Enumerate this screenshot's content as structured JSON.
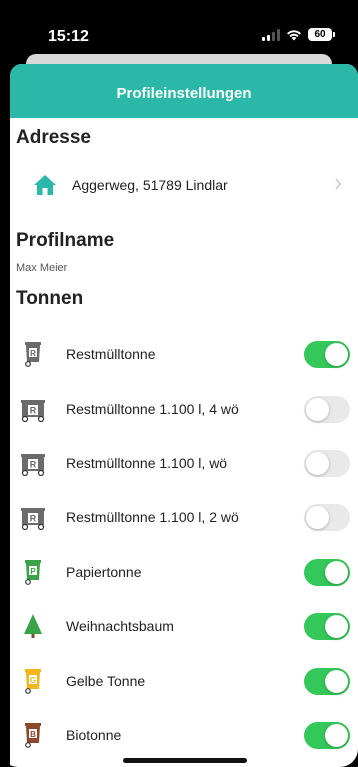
{
  "status_bar": {
    "time": "15:12",
    "battery": "60"
  },
  "header": {
    "title": "Profileinstellungen"
  },
  "sections": {
    "address_title": "Adresse",
    "address_value": "Aggerweg, 51789 Lindlar",
    "profile_title": "Profilname",
    "profile_value": "Max Meier",
    "bins_title": "Tonnen"
  },
  "bins": [
    {
      "label": "Restmülltonne",
      "letter": "R",
      "icon": "small-bin-icon",
      "color": "#6b6b6b",
      "enabled": true
    },
    {
      "label": "Restmülltonne 1.100 l, 4 wö",
      "letter": "R",
      "icon": "large-container-icon",
      "color": "#6b6b6b",
      "enabled": false
    },
    {
      "label": "Restmülltonne 1.100 l, wö",
      "letter": "R",
      "icon": "large-container-icon",
      "color": "#6b6b6b",
      "enabled": false
    },
    {
      "label": "Restmülltonne 1.100 l, 2 wö",
      "letter": "R",
      "icon": "large-container-icon",
      "color": "#6b6b6b",
      "enabled": false
    },
    {
      "label": "Papiertonne",
      "letter": "P",
      "icon": "small-bin-icon",
      "color": "#3aa34a",
      "enabled": true
    },
    {
      "label": "Weihnachtsbaum",
      "letter": "",
      "icon": "tree-icon",
      "color": "#3aa34a",
      "enabled": true
    },
    {
      "label": "Gelbe Tonne",
      "letter": "G",
      "icon": "small-bin-icon",
      "color": "#f2b71c",
      "enabled": true
    },
    {
      "label": "Biotonne",
      "letter": "B",
      "icon": "small-bin-icon",
      "color": "#8b4a2b",
      "enabled": true
    }
  ],
  "colors": {
    "accent": "#2cb8a8",
    "toggle_on": "#34c759",
    "home_icon": "#2cb8a8"
  }
}
